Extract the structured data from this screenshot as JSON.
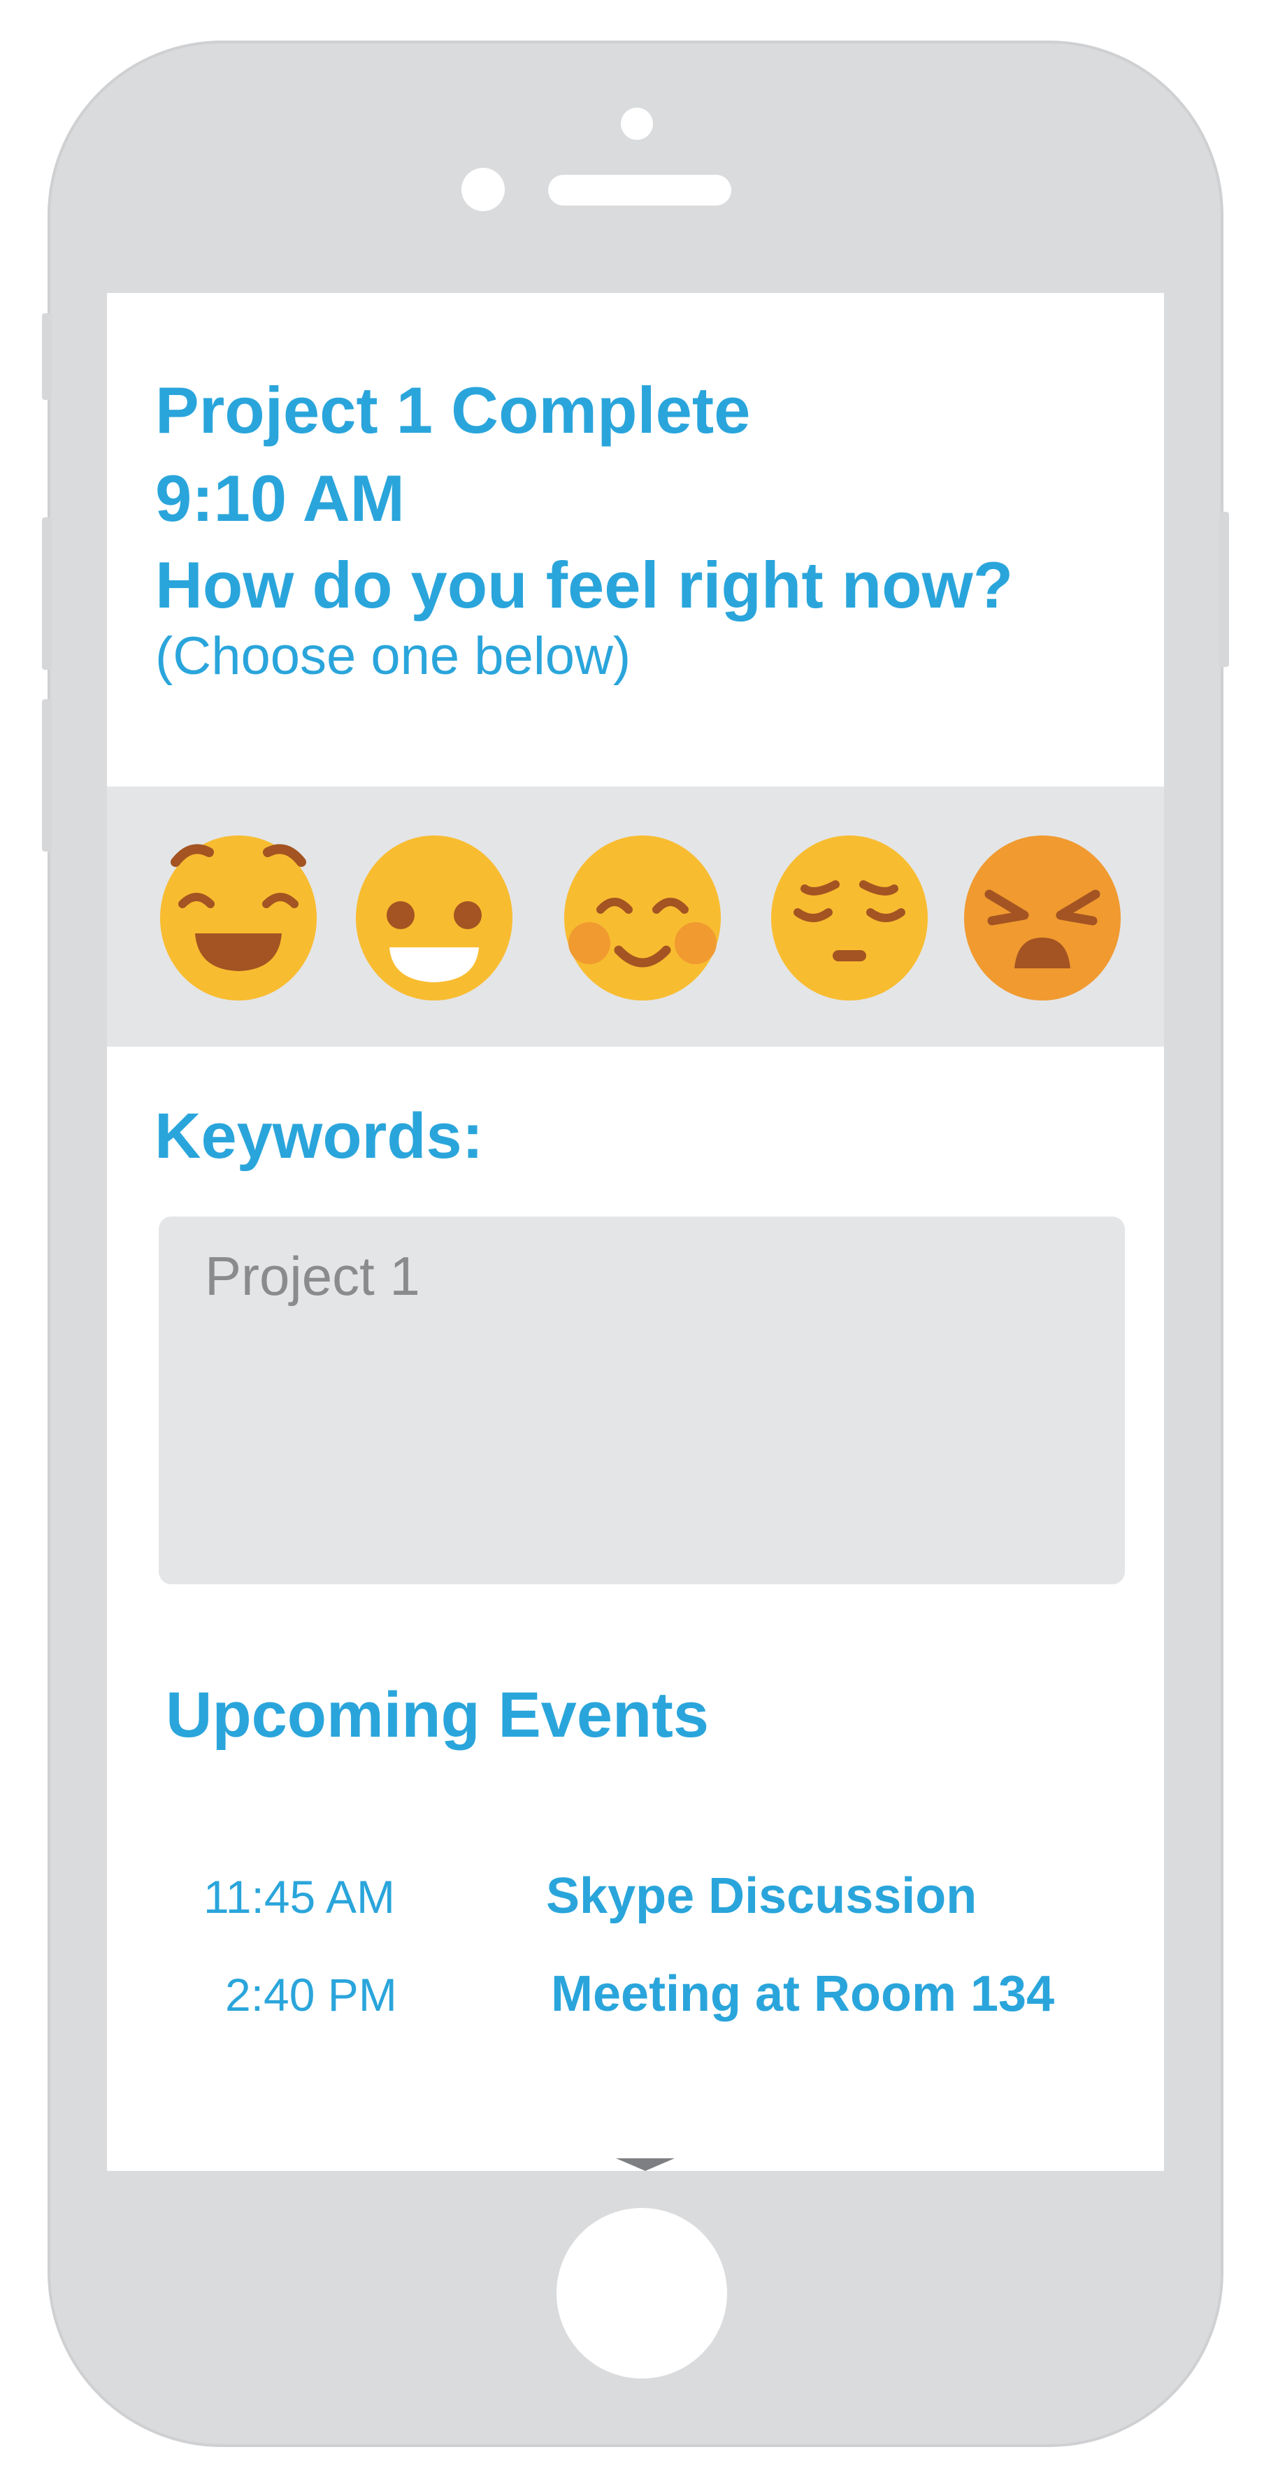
{
  "header": {
    "title": "Project 1 Complete",
    "time": "9:10 AM",
    "question": "How do you feel right now?",
    "hint": "(Choose one below)"
  },
  "moods": [
    {
      "icon": "grinning-face-icon",
      "face": "#f8bc30"
    },
    {
      "icon": "smiling-face-icon",
      "face": "#f8bc30"
    },
    {
      "icon": "blushing-face-icon",
      "face": "#f8bc30"
    },
    {
      "icon": "pensive-face-icon",
      "face": "#f8bc30"
    },
    {
      "icon": "angry-face-icon",
      "face": "#f09a30"
    }
  ],
  "keywords": {
    "label": "Keywords:",
    "value": "Project 1"
  },
  "events": {
    "title": "Upcoming Events",
    "items": [
      {
        "time": "11:45 AM",
        "name": "Skype Discussion"
      },
      {
        "time": "2:40 PM",
        "name": "Meeting at Room 134"
      }
    ]
  },
  "colors": {
    "accent": "#2aa5db",
    "phone_body": "#dadbdc",
    "band": "#e4e5e6",
    "feature": "#a35422"
  }
}
